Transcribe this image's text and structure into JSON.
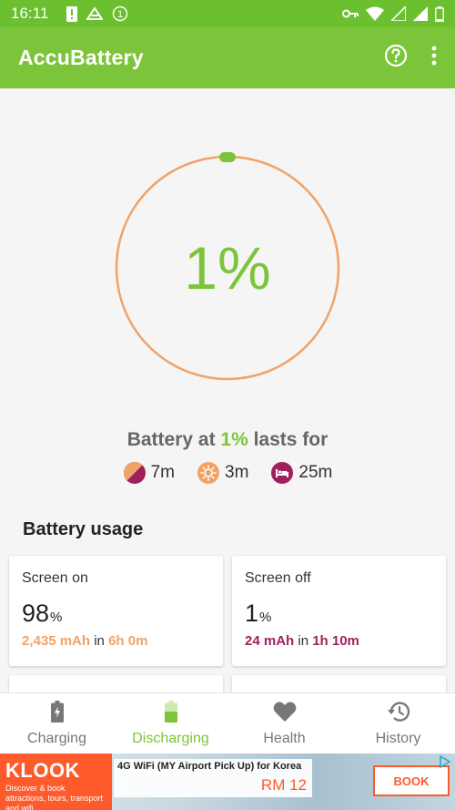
{
  "status_bar": {
    "time": "16:11",
    "notification_count": "1"
  },
  "app_bar": {
    "title": "AccuBattery",
    "help_icon": "help-circle-icon",
    "more_icon": "more-vert-icon"
  },
  "gauge": {
    "percent_text": "1%",
    "level": 0.01,
    "ring_color": "#f0a368",
    "indicator_color": "#7cc53a"
  },
  "lasts_for": {
    "prefix": "Battery at ",
    "highlight": "1%",
    "suffix": " lasts for"
  },
  "estimates": [
    {
      "icon": "mixed-usage-icon",
      "value": "7m"
    },
    {
      "icon": "screen-on-sun-icon",
      "value": "3m"
    },
    {
      "icon": "sleep-bed-icon",
      "value": "25m"
    }
  ],
  "battery_usage": {
    "title": "Battery usage",
    "screen_on": {
      "label": "Screen on",
      "value": "98",
      "unit": "%",
      "mah": "2,435 mAh",
      "in": " in ",
      "duration": "6h 0m"
    },
    "screen_off": {
      "label": "Screen off",
      "value": "1",
      "unit": "%",
      "mah": "24 mAh",
      "in": " in ",
      "duration": "1h 10m"
    }
  },
  "bottom_nav": [
    {
      "label": "Charging",
      "icon": "battery-charging-icon",
      "active": false
    },
    {
      "label": "Discharging",
      "icon": "battery-discharging-icon",
      "active": true
    },
    {
      "label": "Health",
      "icon": "heart-icon",
      "active": false
    },
    {
      "label": "History",
      "icon": "history-icon",
      "active": false
    }
  ],
  "ad": {
    "brand": "KLOOK",
    "tagline": "Discover & book attractions, tours, transport and wifi",
    "offer_title": "4G WiFi (MY Airport Pick Up) for Korea",
    "price": "RM 12",
    "cta": "BOOK"
  },
  "colors": {
    "primary": "#7cc53a",
    "status_bar": "#6cc02f",
    "screen_on_accent": "#f0a368",
    "screen_off_accent": "#a0205d",
    "ad_brand": "#ff5a2b"
  }
}
